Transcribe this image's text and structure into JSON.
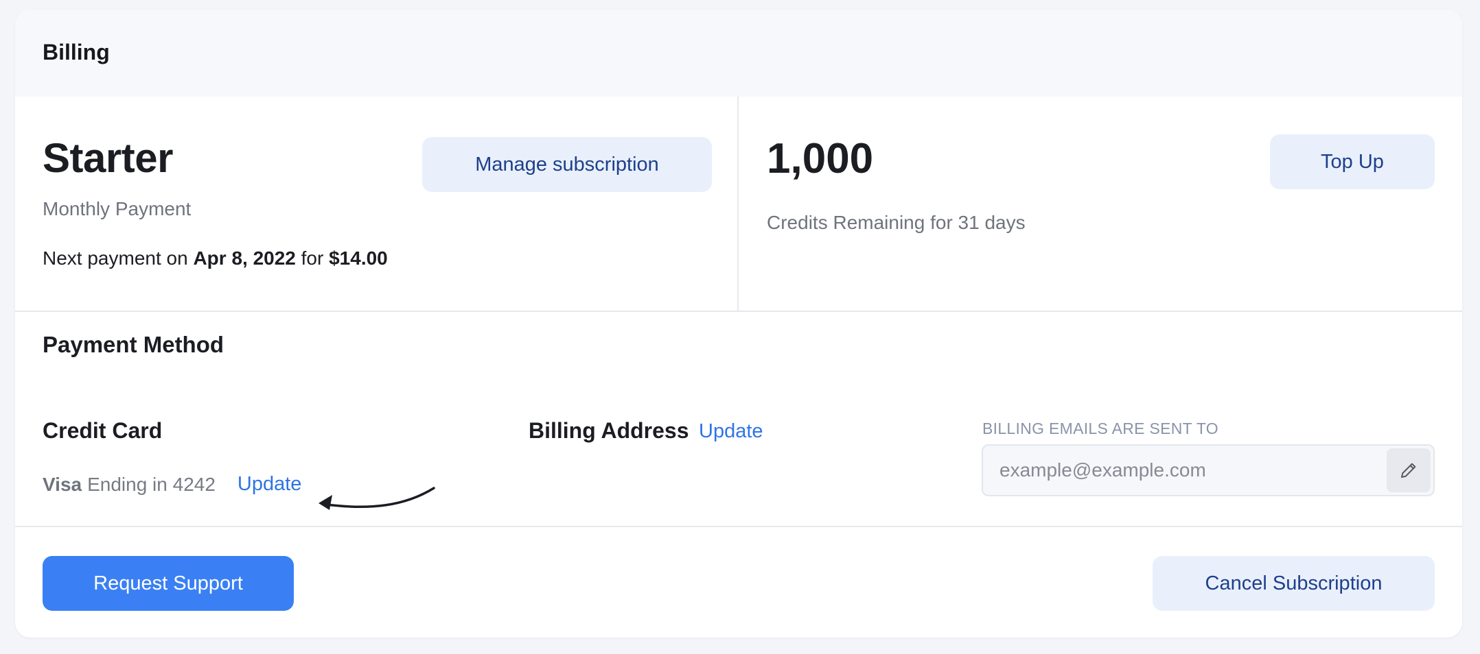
{
  "header": {
    "title": "Billing"
  },
  "plan": {
    "name": "Starter",
    "period": "Monthly Payment",
    "next_payment_prefix": "Next payment on ",
    "next_payment_date": "Apr 8, 2022",
    "next_payment_mid": " for ",
    "next_payment_amount": "$14.00",
    "manage_label": "Manage subscription"
  },
  "credits": {
    "amount": "1,000",
    "label": "Credits Remaining for 31 days",
    "topup_label": "Top Up"
  },
  "payment_method": {
    "title": "Payment Method",
    "credit_card": {
      "title": "Credit Card",
      "brand": "Visa",
      "ending": "Ending in 4242",
      "update_label": "Update"
    },
    "billing_address": {
      "title": "Billing Address",
      "update_label": "Update"
    },
    "billing_emails": {
      "label": "BILLING EMAILS ARE SENT TO",
      "placeholder": "example@example.com",
      "value": ""
    }
  },
  "footer": {
    "support_label": "Request Support",
    "cancel_label": "Cancel Subscription"
  },
  "colors": {
    "primary": "#3a80f4",
    "link": "#2f74e6",
    "soft_button_bg": "#e9f0fc",
    "soft_button_text": "#1e3f8a"
  },
  "icons": {
    "edit": "pencil-icon",
    "annotation": "curved-arrow-icon"
  }
}
